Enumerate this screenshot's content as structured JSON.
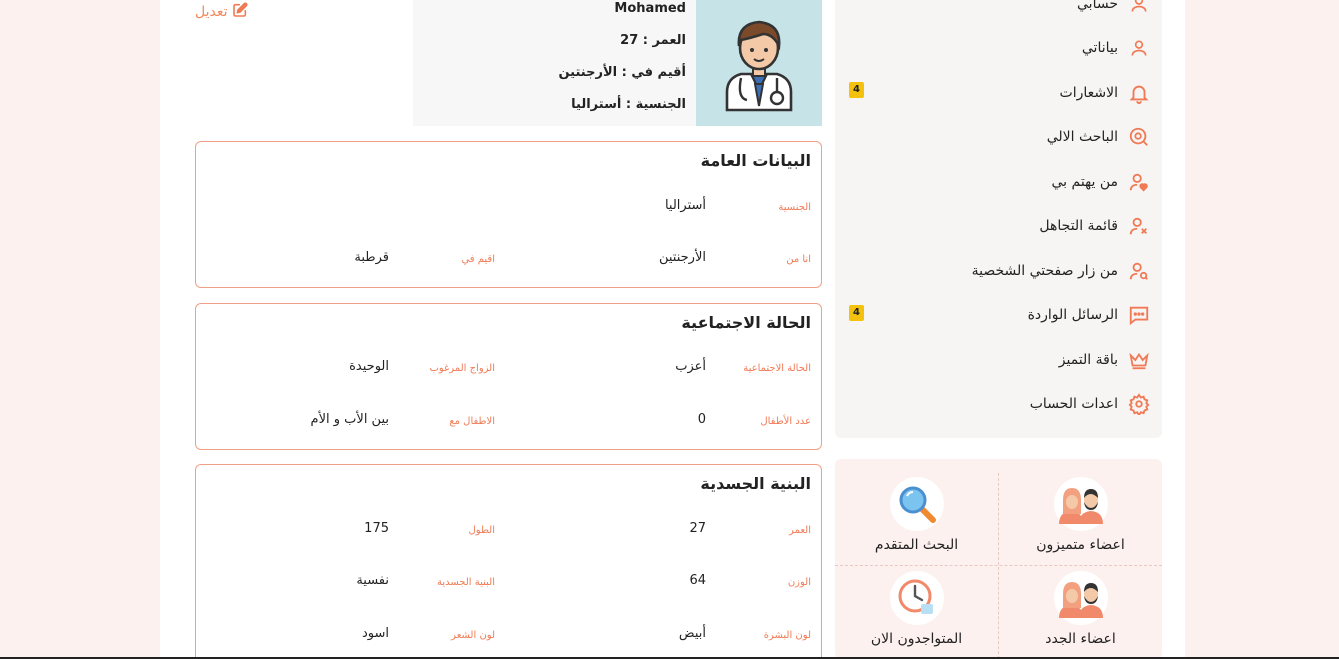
{
  "profile": {
    "edit_label": "تعديل",
    "name": "Mohamed",
    "age_line": "العمر : 27",
    "residence_line": "أقيم في : الأرجنتين",
    "nationality_line": "الجنسية : أستراليا"
  },
  "general": {
    "title": "البيانات العامة",
    "nationality_label": "الجنسية",
    "nationality_value": "أستراليا",
    "from_label": "انا من",
    "from_value": "الأرجنتين",
    "residence_label": "اقيم في",
    "residence_value": "قرطبة"
  },
  "social": {
    "title": "الحالة الاجتماعية",
    "marital_label": "الحالة الاجتماعية",
    "marital_value": "أعزب",
    "marriage_type_label": "الزواج المرغوب",
    "marriage_type_value": "الوحيدة",
    "children_label": "عدد الأطفال",
    "children_value": "0",
    "children_with_label": "الاطفال مع",
    "children_with_value": "بين الأب و الأم"
  },
  "physical": {
    "title": "البنية الجسدية",
    "age_label": "العمر",
    "age_value": "27",
    "height_label": "الطول",
    "height_value": "175",
    "weight_label": "الوزن",
    "weight_value": "64",
    "build_label": "البنية الجسدية",
    "build_value": "نفسية",
    "skin_label": "لون البشرة",
    "skin_value": "أبيض",
    "hair_label": "لون الشعر",
    "hair_value": "اسود"
  },
  "menu": {
    "items": [
      {
        "label": "حسابي",
        "icon": "user-icon"
      },
      {
        "label": "بياناتي",
        "icon": "user-icon"
      },
      {
        "label": "الاشعارات",
        "icon": "bell-icon",
        "badge": "4"
      },
      {
        "label": "الباحث الالي",
        "icon": "auto-search-icon"
      },
      {
        "label": "من يهتم بي",
        "icon": "user-heart-icon"
      },
      {
        "label": "قائمة التجاهل",
        "icon": "user-block-icon"
      },
      {
        "label": "من زار صفحتي الشخصية",
        "icon": "user-search-icon"
      },
      {
        "label": "الرسائل الواردة",
        "icon": "message-icon",
        "badge": "4"
      },
      {
        "label": "باقة التميز",
        "icon": "crown-icon"
      },
      {
        "label": "اعدات الحساب",
        "icon": "gear-icon"
      }
    ]
  },
  "quick_links": {
    "featured_members": "اعضاء متميزون",
    "advanced_search": "البحث المتقدم",
    "new_members": "اعضاء الجدد",
    "online_now": "المتواجدون الان"
  },
  "colors": {
    "accent": "#f07a55",
    "card_border": "#f0a185",
    "badge": "#f4c20d",
    "avatar_bg": "#c6e3e7",
    "page_bg": "#fdf1ef"
  }
}
